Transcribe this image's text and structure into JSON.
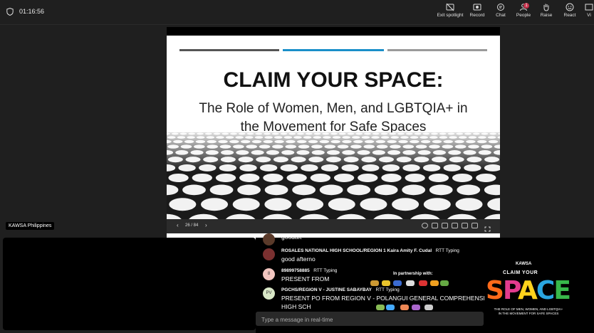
{
  "meeting": {
    "timer": "01:16:56",
    "toolbar": [
      {
        "label": "Exit spotlight",
        "icon": "exit-spotlight-icon"
      },
      {
        "label": "Record",
        "icon": "record-icon"
      },
      {
        "label": "Chat",
        "icon": "chat-icon"
      },
      {
        "label": "People",
        "icon": "people-icon",
        "badge": "1"
      },
      {
        "label": "Raise",
        "icon": "hand-icon"
      },
      {
        "label": "React",
        "icon": "smile-icon"
      },
      {
        "label": "Vi",
        "icon": "view-icon"
      }
    ]
  },
  "slide": {
    "title": "CLAIM YOUR SPACE:",
    "subtitle_line1": "The Role of Women, Men, and LGBTQIA+ in",
    "subtitle_line2": "the Movement for Safe Spaces",
    "page_indicator": "26 / 84",
    "prev": "‹",
    "next": "›"
  },
  "presenter": {
    "name": "KAWSA Philippines"
  },
  "chat": {
    "messages": [
      {
        "sender": "",
        "status": "",
        "text": "goodaft",
        "initials": ""
      },
      {
        "sender": "ROSALES NATIONAL HIGH SCHOOL/REGION 1 Kaira Amity F. Cudal",
        "status": "RTT Typing",
        "text": "good afterno",
        "initials": ""
      },
      {
        "sender": "89899758885",
        "status": "RTT Typing",
        "text": "PRESENT FROM",
        "initials": "8"
      },
      {
        "sender": "PGCHS/REGION V - JUSTINE SABAYBAY",
        "status": "RTT Typing",
        "text": "PRESENT PO FROM REGION V - POLANGUI GENERAL COMPREHENSI",
        "text2": "HIGH SCH",
        "initials": "PV"
      }
    ],
    "input_placeholder": "Type a message in real-time"
  },
  "overlay": {
    "partnership": "In partnership with:",
    "kawsa": "KAWSA",
    "claim": "CLAIM YOUR",
    "space": "SPACE",
    "tagline": "THE ROLE OF MEN, WOMEN, AND LGBTQIA+ IN THE MOVEMENT FOR SAFE SPACES"
  },
  "colors": {
    "accent_bar_left": "#555555",
    "accent_bar_mid": "#1a8fc9",
    "accent_bar_right": "#9a9a9a",
    "badge": "#c4314b"
  }
}
